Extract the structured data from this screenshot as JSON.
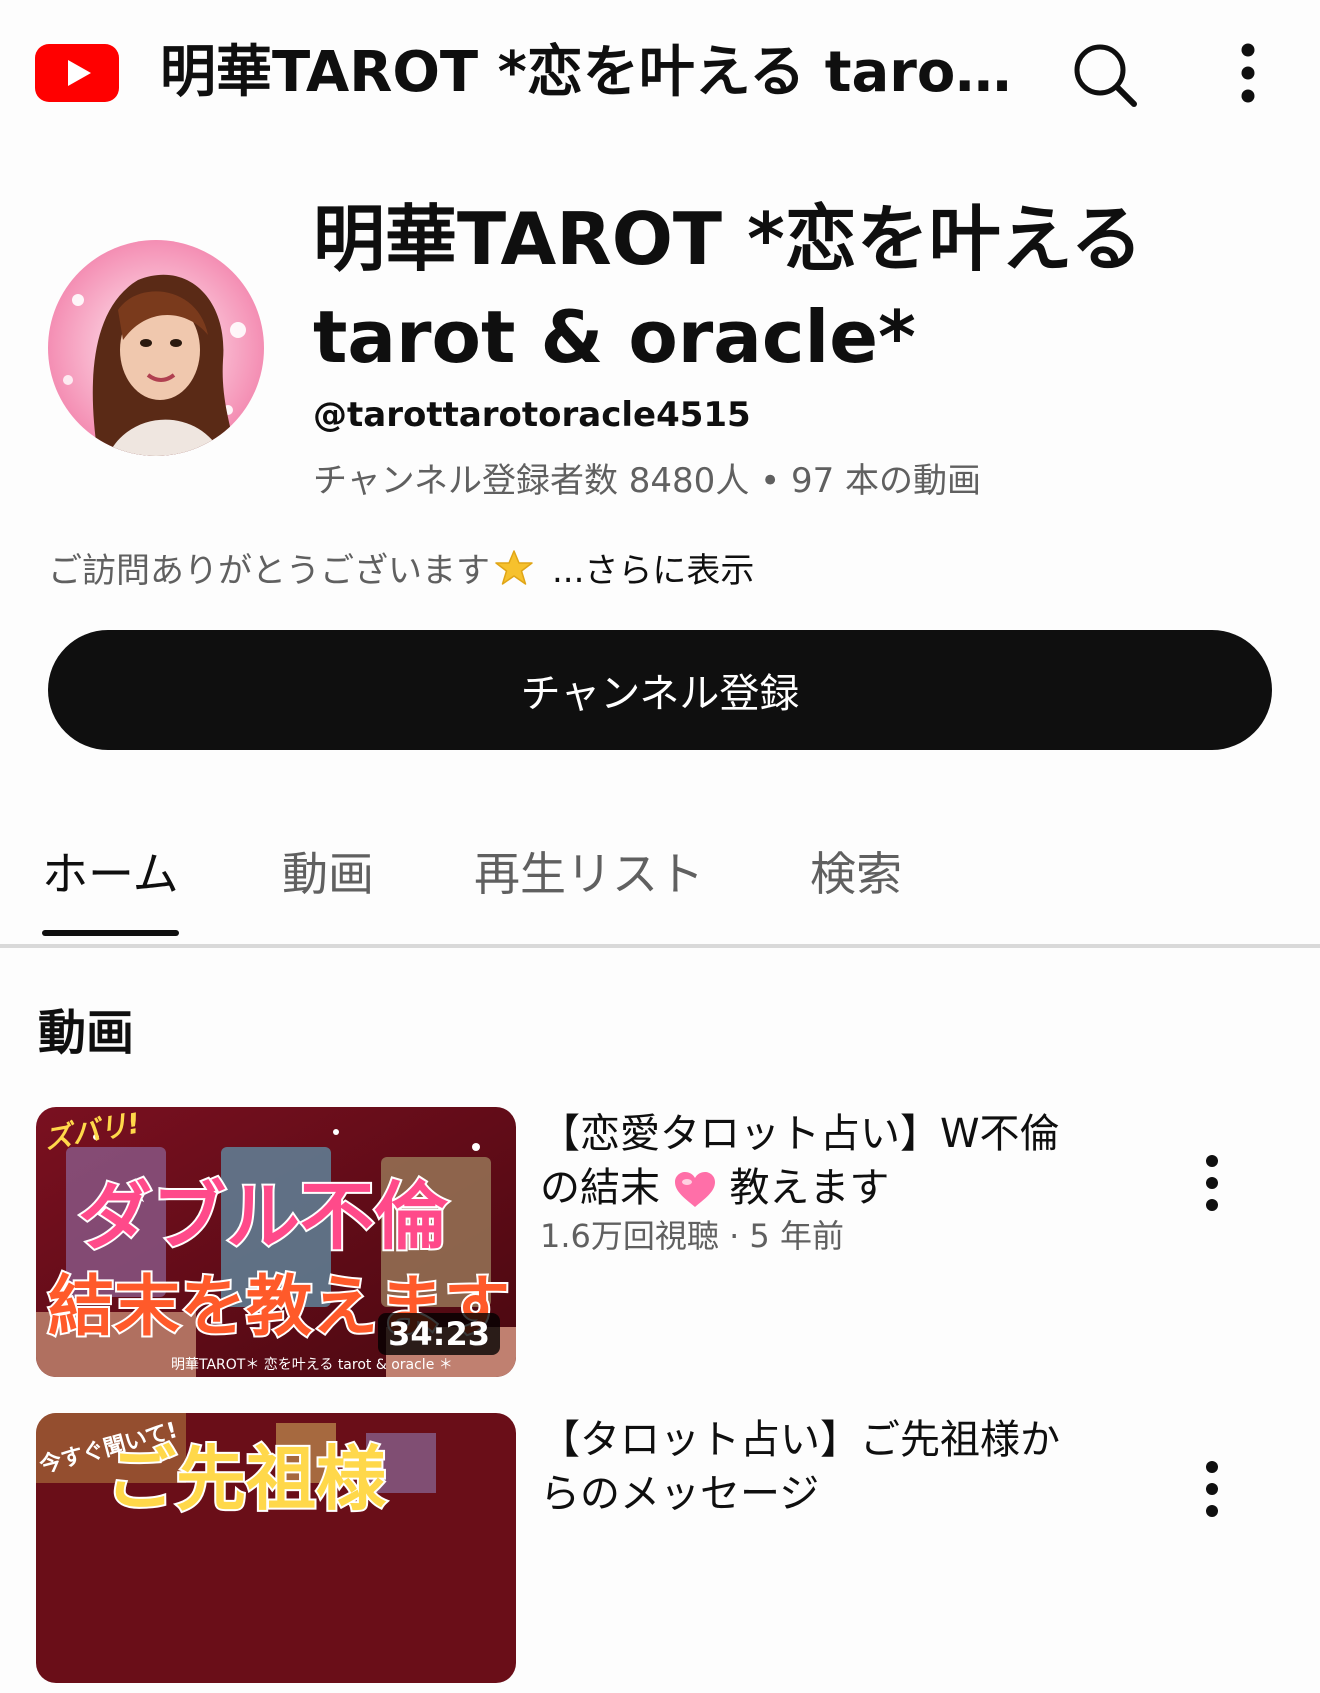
{
  "colors": {
    "brand_red": "#ff0000",
    "subscribe_bg": "#0f0f0f",
    "secondary_text": "#606060"
  },
  "header": {
    "title": "明華TAROT *恋を叶える tarot & oracle*",
    "logo_icon": "youtube-logo",
    "search_icon": "search-icon",
    "more_icon": "more-vert-icon"
  },
  "channel": {
    "name": "明華TAROT *恋を叶える tarot & oracle*",
    "handle": "@tarottarotoracle4515",
    "stats": "チャンネル登録者数 8480人 • 97 本の動画",
    "description": "ご訪問ありがとうございます",
    "more_link": "...さらに表示",
    "subscribe_label": "チャンネル登録"
  },
  "tabs": [
    {
      "label": "ホーム",
      "active": true
    },
    {
      "label": "動画",
      "active": false
    },
    {
      "label": "再生リスト",
      "active": false
    },
    {
      "label": "検索",
      "active": false
    }
  ],
  "section": {
    "title": "動画"
  },
  "videos": [
    {
      "title_line1": "【恋愛タロット占い】W不倫",
      "title_line2a": "の結末",
      "title_line2b": "教えます",
      "meta": "1.6万回視聴 · 5 年前",
      "duration": "34:23",
      "thumb_text_top": "ズバリ!",
      "thumb_text_main": "ダブル不倫",
      "thumb_text_sub": "結末を教えます",
      "thumb_footer": "明華TAROT＊ 恋を叶える tarot & oracle ＊"
    },
    {
      "title_line1": "【タロット占い】ご先祖様か",
      "title_line2a": "らのメッセージ",
      "thumb_text_top": "今すぐ聞いて!",
      "thumb_text_main": "ご先祖様"
    }
  ]
}
